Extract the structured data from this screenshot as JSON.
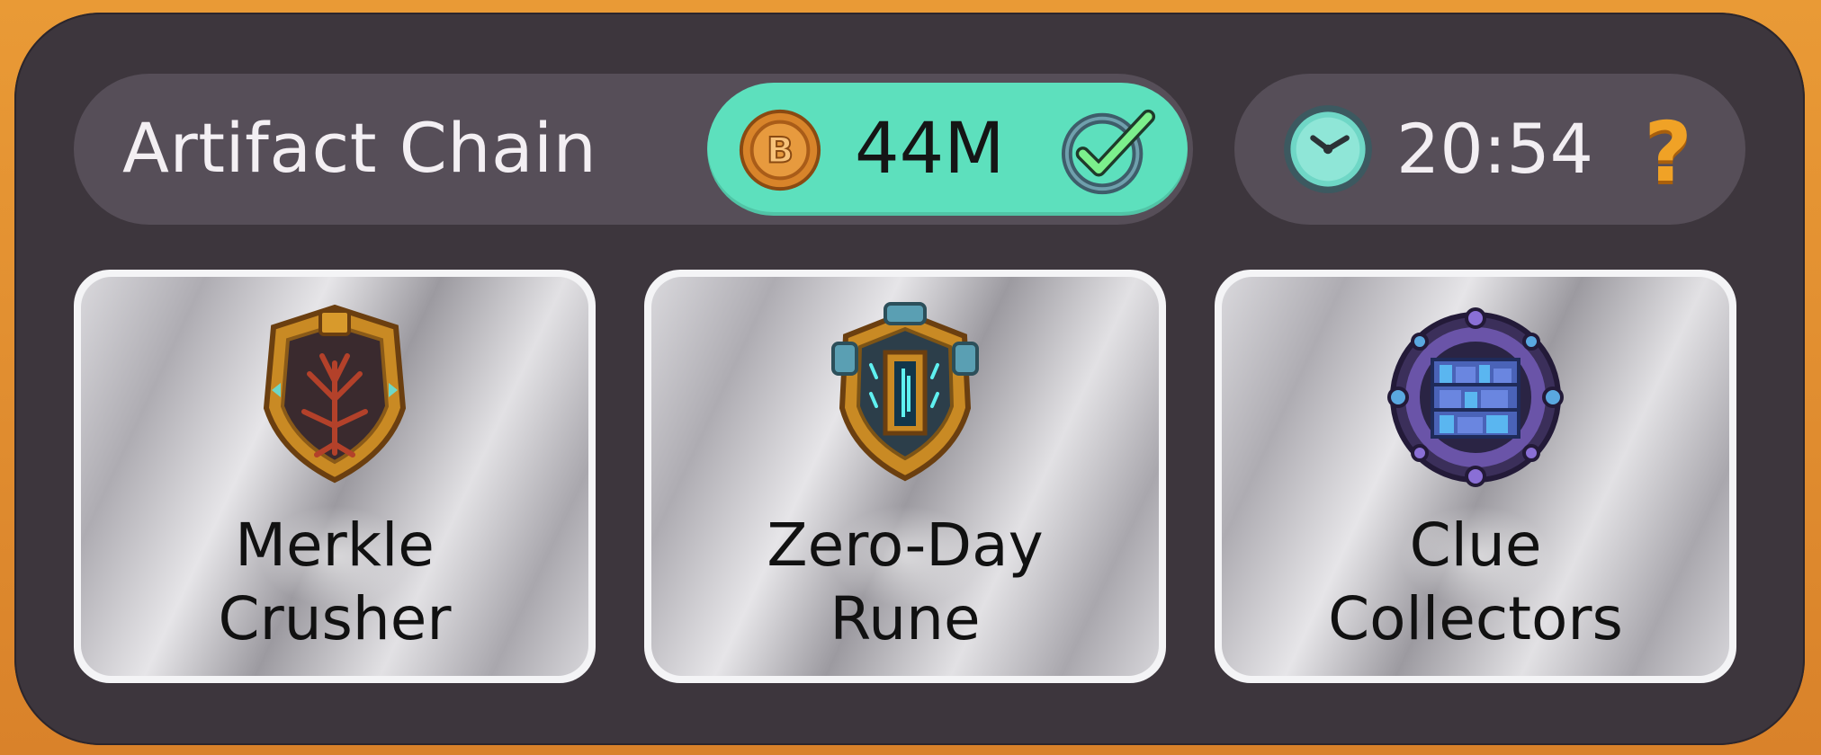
{
  "header": {
    "title": "Artifact Chain",
    "currency": {
      "icon": "coin-icon",
      "value": "44M",
      "status_icon": "check-icon",
      "pill_color": "#5de0bd"
    },
    "timer": {
      "icon": "clock-icon",
      "value": "20:54",
      "help_icon": "question-icon",
      "help_label": "?"
    }
  },
  "cards": [
    {
      "label": "Merkle\nCrusher",
      "icon": "tree-shield-icon"
    },
    {
      "label": "Zero-Day\nRune",
      "icon": "portal-shield-icon"
    },
    {
      "label": "Clue\nCollectors",
      "icon": "bookshelf-badge-icon"
    }
  ],
  "colors": {
    "frame": "#e08a2c",
    "panel": "#3d363d",
    "bar": "#564e58",
    "accent_green": "#5de0bd",
    "accent_orange": "#f0a226"
  }
}
